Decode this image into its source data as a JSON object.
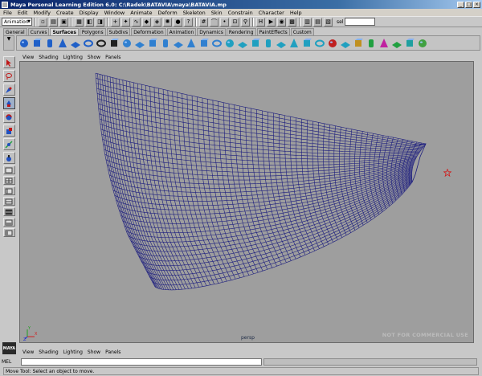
{
  "window": {
    "title": "Maya Personal Learning Edition 6.0: C:\\Radek\\BATAVIA\\maya\\BATAVIA.mp",
    "buttons": [
      "_",
      "□",
      "×"
    ]
  },
  "menubar": [
    "File",
    "Edit",
    "Modify",
    "Create",
    "Display",
    "Window",
    "Animate",
    "Deform",
    "Skeleton",
    "Skin",
    "Constrain",
    "Character",
    "Help"
  ],
  "statusline": {
    "mode": "Animation",
    "selection_label": "sel",
    "selection_value": ""
  },
  "shelf_tabs": [
    "General",
    "Curves",
    "Surfaces",
    "Polygons",
    "Subdivs",
    "Deformation",
    "Animation",
    "Dynamics",
    "Rendering",
    "PaintEffects",
    "Custom"
  ],
  "active_tab": "Surfaces",
  "panel_menu": [
    "View",
    "Shading",
    "Lighting",
    "Show",
    "Panels"
  ],
  "viewport": {
    "camera": "persp",
    "watermark": "NOT FOR COMMERCIAL USE",
    "wire_color": "#1c1d7e",
    "background": "#9e9e9e",
    "axis": {
      "x": "X",
      "y": "Y",
      "z": "Z"
    }
  },
  "logo_text": "MAYA",
  "cmdline": {
    "label": "MEL",
    "value": ""
  },
  "helpline": "Move Tool: Select an object to move."
}
